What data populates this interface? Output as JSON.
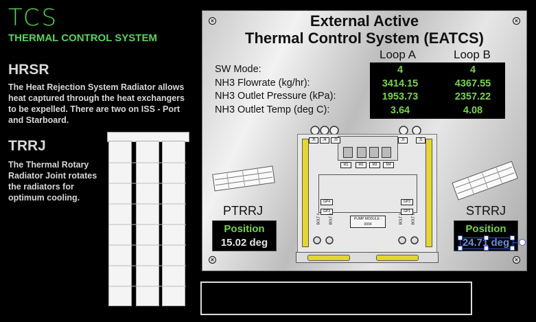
{
  "sidebar": {
    "title": "TCS",
    "subtitle": "THERMAL CONTROL SYSTEM",
    "hrsr_heading": "HRSR",
    "hrsr_text": "The Heat Rejection System Radiator allows heat captured through the heat exchangers to be expelled. There are two on ISS - Port and Starboard.",
    "trrj_heading": "TRRJ",
    "trrj_text": "The Thermal Rotary Radiator Joint rotates the radiators for optimum cooling."
  },
  "panel": {
    "title_line1": "External Active",
    "title_line2": "Thermal Control System (EATCS)",
    "loop_a": "Loop A",
    "loop_b": "Loop B",
    "rows": [
      {
        "label": "SW Mode:",
        "a": "4",
        "b": "4"
      },
      {
        "label": "NH3 Flowrate (kg/hr):",
        "a": "3414.15",
        "b": "4367.55"
      },
      {
        "label": "NH3 Outlet Pressure (kPa):",
        "a": "1953.73",
        "b": "2357.22"
      },
      {
        "label": "NH3 Outlet Temp (deg C):",
        "a": "3.64",
        "b": "4.08"
      }
    ],
    "ptrrj": {
      "label": "PTRRJ",
      "position_label": "Position",
      "value": "15.02 deg"
    },
    "strrj": {
      "label": "STRRJ",
      "position_label": "Position",
      "value": "24.71 deg"
    },
    "pump": {
      "module_label": "PUMP MODULE - 0004",
      "tags_top": [
        "J5",
        "J4",
        "J3",
        "J2",
        "J1"
      ],
      "tags_mid": [
        "M1",
        "M2",
        "M3",
        "M4"
      ],
      "gp_left": [
        "GP4",
        "GP3"
      ],
      "gp_right": [
        "GP2",
        "GP1"
      ],
      "bolts": [
        "BOLT 4",
        "BOLT 3",
        "BOLT 2",
        "BOLT 1"
      ]
    }
  },
  "colors": {
    "accent": "#59d459",
    "value": "#7ad34f"
  }
}
